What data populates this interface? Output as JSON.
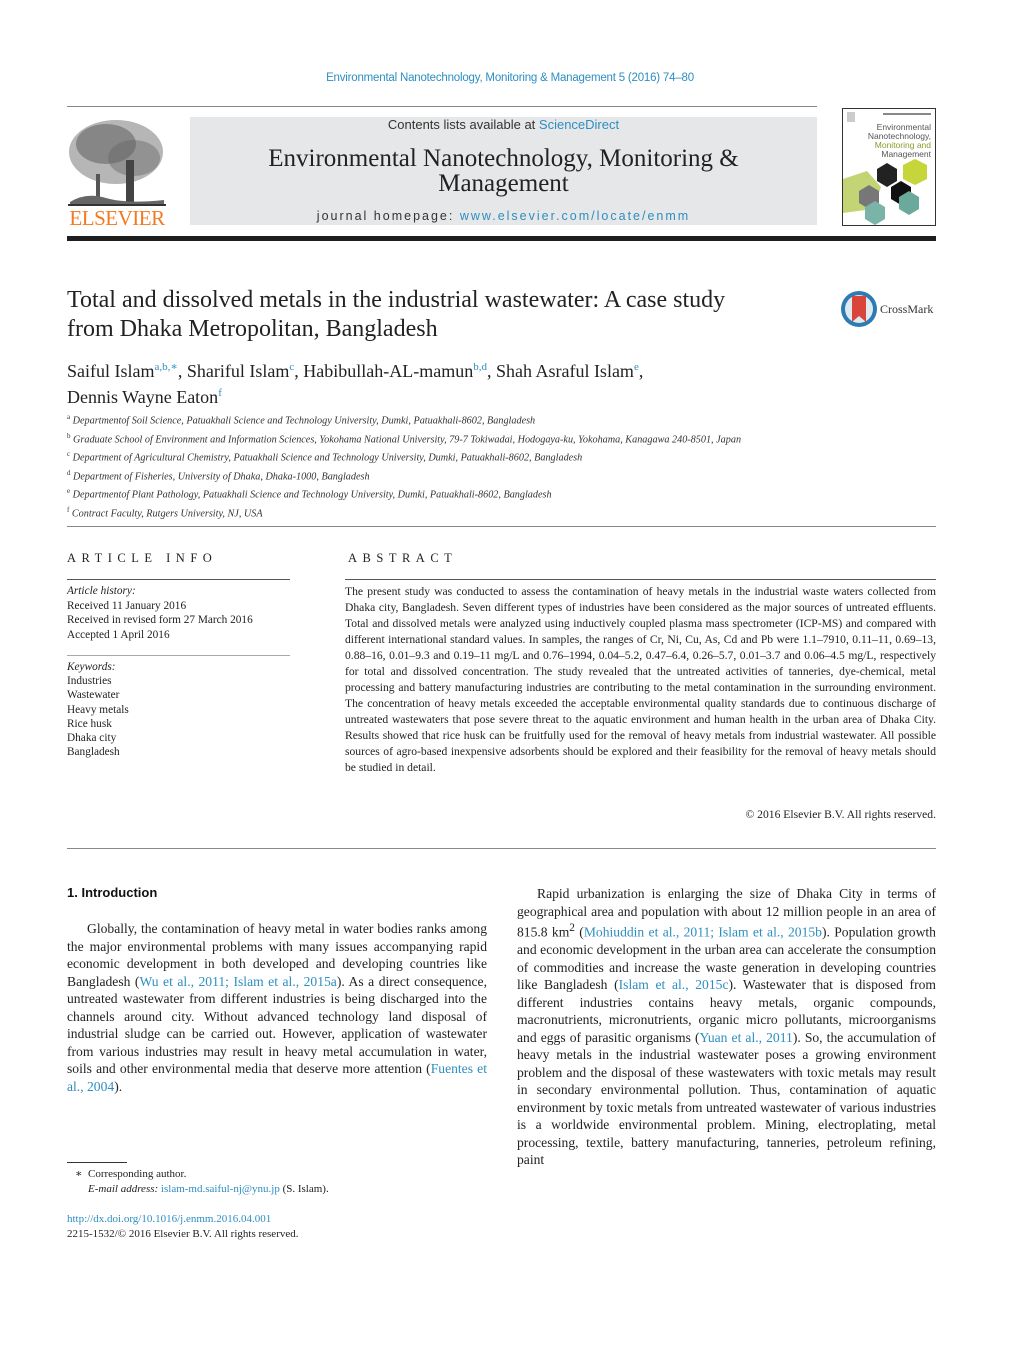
{
  "header": {
    "journal_reference": "Environmental Nanotechnology, Monitoring & Management 5 (2016) 74–80",
    "contents_prefix": "Contents lists available at ",
    "contents_link": "ScienceDirect",
    "journal_title_line1": "Environmental Nanotechnology, Monitoring &",
    "journal_title_line2": "Management",
    "homepage_prefix": "journal homepage: ",
    "homepage_url": "www.elsevier.com/locate/enmm",
    "publisher_logo_text": "ELSEVIER",
    "cover": {
      "title_lines": [
        "Environmental",
        "Nanotechnology,",
        "Monitoring and",
        "Management"
      ]
    }
  },
  "article": {
    "title_line1": "Total and dissolved metals in the industrial wastewater: A case study",
    "title_line2": "from Dhaka Metropolitan, Bangladesh",
    "crossmark_label": "CrossMark",
    "authors": [
      {
        "name": "Saiful Islam",
        "sup": "a,b,∗",
        "sep": ", "
      },
      {
        "name": "Shariful Islam",
        "sup": "c",
        "sep": ", "
      },
      {
        "name": "Habibullah-AL-mamun",
        "sup": "b,d",
        "sep": ", "
      },
      {
        "name": "Shah Asraful Islam",
        "sup": "e",
        "sep": ","
      },
      {
        "name": "Dennis Wayne Eaton",
        "sup": "f",
        "sep": ""
      }
    ],
    "affiliations": [
      {
        "key": "a",
        "text": "Departmentof Soil Science, Patuakhali Science and Technology University, Dumki, Patuakhali-8602, Bangladesh"
      },
      {
        "key": "b",
        "text": "Graduate School of Environment and Information Sciences, Yokohama National University, 79-7 Tokiwadai, Hodogaya-ku, Yokohama, Kanagawa 240-8501, Japan"
      },
      {
        "key": "c",
        "text": "Department of Agricultural Chemistry, Patuakhali Science and Technology University, Dumki, Patuakhali-8602, Bangladesh"
      },
      {
        "key": "d",
        "text": "Department of Fisheries, University of Dhaka, Dhaka-1000, Bangladesh"
      },
      {
        "key": "e",
        "text": "Departmentof Plant Pathology, Patuakhali Science and Technology University, Dumki, Patuakhali-8602, Bangladesh"
      },
      {
        "key": "f",
        "text": "Contract Faculty, Rutgers University, NJ, USA"
      }
    ]
  },
  "article_info": {
    "heading": "ARTICLE INFO",
    "history_label": "Article history:",
    "history": [
      "Received 11 January 2016",
      "Received in revised form 27 March 2016",
      "Accepted 1 April 2016"
    ],
    "keywords_label": "Keywords:",
    "keywords": [
      "Industries",
      "Wastewater",
      "Heavy metals",
      "Rice husk",
      "Dhaka city",
      "Bangladesh"
    ]
  },
  "abstract": {
    "heading": "ABSTRACT",
    "text": "The present study was conducted to assess the contamination of heavy metals in the industrial waste waters collected from Dhaka city, Bangladesh. Seven different types of industries have been considered as the major sources of untreated effluents. Total and dissolved metals were analyzed using inductively coupled plasma mass spectrometer (ICP-MS) and compared with different international standard values. In samples, the ranges of Cr, Ni, Cu, As, Cd and Pb were 1.1–7910, 0.11–11, 0.69–13, 0.88–16, 0.01–9.3 and 0.19–11 mg/L and 0.76–1994, 0.04–5.2, 0.47–6.4, 0.26–5.7, 0.01–3.7 and 0.06–4.5 mg/L, respectively for total and dissolved concentration. The study revealed that the untreated activities of tanneries, dye-chemical, metal processing and battery manufacturing industries are contributing to the metal contamination in the surrounding environment. The concentration of heavy metals exceeded the acceptable environmental quality standards due to continuous discharge of untreated wastewaters that pose severe threat to the aquatic environment and human health in the urban area of Dhaka City. Results showed that rice husk can be fruitfully used for the removal of heavy metals from industrial wastewater. All possible sources of agro-based inexpensive adsorbents should be explored and their feasibility for the removal of heavy metals should be studied in detail.",
    "copyright": "© 2016 Elsevier B.V. All rights reserved."
  },
  "introduction": {
    "heading": "1.  Introduction",
    "left_para": [
      {
        "t": "Globally, the contamination of heavy metal in water bodies ranks among the major environmental problems with many issues accompanying rapid economic development in both developed and developing countries like Bangladesh ("
      },
      {
        "c": "Wu et al., 2011; Islam et al., 2015a"
      },
      {
        "t": "). As a direct consequence, untreated wastewater from different industries is being discharged into the channels around city. Without advanced technology land disposal of industrial sludge can be carried out. However, application of wastewater from various industries may result in heavy metal accumulation in water, soils and other environmental media that deserve more attention ("
      },
      {
        "c": "Fuentes et al., 2004"
      },
      {
        "t": ")."
      }
    ],
    "right_para": [
      {
        "t": "Rapid urbanization is enlarging the size of Dhaka City in terms of geographical area and population with about 12 million people in an area of 815.8 km"
      },
      {
        "sup": "2"
      },
      {
        "t": " ("
      },
      {
        "c": "Mohiuddin et al., 2011; Islam et al., 2015b"
      },
      {
        "t": "). Population growth and economic development in the urban area can accelerate the consumption of commodities and increase the waste generation in developing countries like Bangladesh ("
      },
      {
        "c": "Islam et al., 2015c"
      },
      {
        "t": "). Wastewater that is disposed from different industries contains heavy metals, organic compounds, macronutrients, micronutrients, organic micro pollutants, microorganisms and eggs of parasitic organisms ("
      },
      {
        "c": "Yuan et al., 2011"
      },
      {
        "t": "). So, the accumulation of heavy metals in the industrial wastewater poses a growing environment problem and the disposal of these wastewaters with toxic metals may result in secondary environmental pollution. Thus, contamination of aquatic environment by toxic metals from untreated wastewater of various industries is a worldwide environmental problem. Mining, electroplating, metal processing, textile, battery manufacturing, tanneries, petroleum refining, paint"
      }
    ]
  },
  "footnote": {
    "marker": "∗",
    "corresponding": "Corresponding author.",
    "email_label": "E-mail address: ",
    "email": "islam-md.saiful-nj@ynu.jp",
    "email_suffix": " (S. Islam).",
    "doi": "http://dx.doi.org/10.1016/j.enmm.2016.04.001",
    "issn_copyright": "2215-1532/© 2016 Elsevier B.V. All rights reserved."
  },
  "colors": {
    "link": "#2e8ec0",
    "elsevier_orange": "#f47a20",
    "banner_gray": "#e6e7e8",
    "crossmark_red": "#d9453b"
  }
}
